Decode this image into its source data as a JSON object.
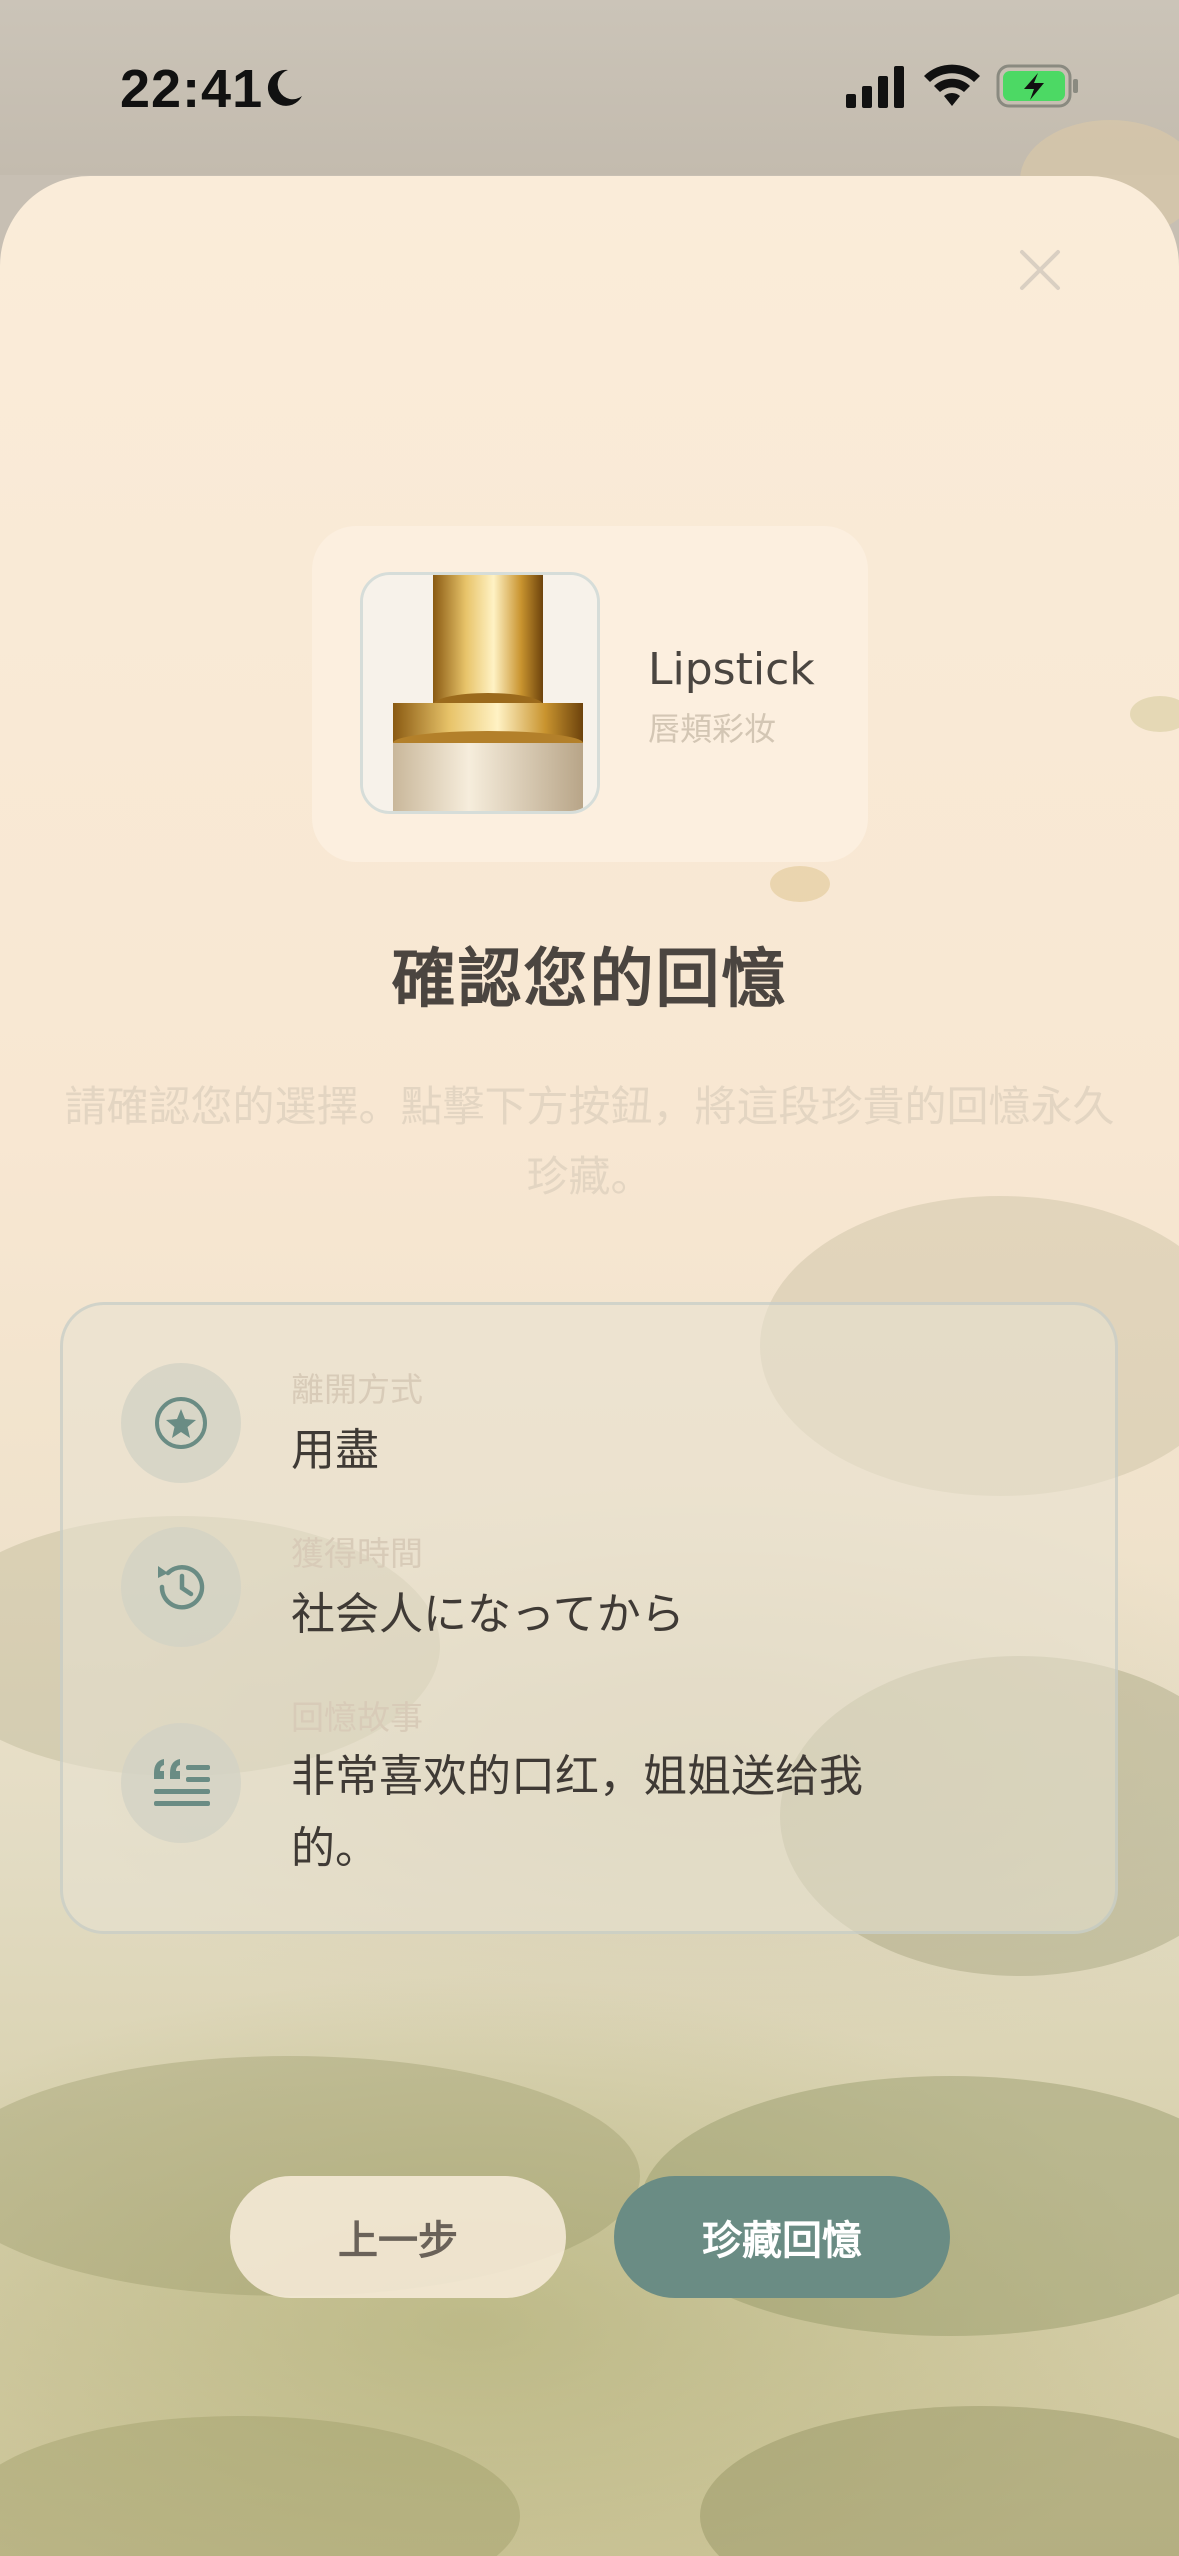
{
  "status_bar": {
    "time": "22:41",
    "moon_icon": "moon-icon",
    "signal_icon": "cellular-signal-icon",
    "wifi_icon": "wifi-icon",
    "battery_icon": "battery-charging-icon",
    "battery_color": "#4cd964"
  },
  "sheet": {
    "close_icon": "close-icon",
    "item": {
      "name": "Lipstick",
      "category": "唇頬彩妆",
      "thumbnail_icon": "lipstick-image"
    },
    "title": "確認您的回憶",
    "subtitle": "請確認您的選擇。點擊下方按鈕，將這段珍貴的回憶永久珍藏。",
    "details": [
      {
        "label": "離開方式",
        "value": "用盡",
        "icon": "star-circle-icon"
      },
      {
        "label": "獲得時間",
        "value": "社会人になってから",
        "icon": "history-icon"
      },
      {
        "label": "回憶故事",
        "value": "非常喜欢的口红，姐姐送给我的。",
        "icon": "quote-text-icon"
      }
    ],
    "buttons": {
      "back_label": "上一步",
      "confirm_label": "珍藏回憶"
    }
  },
  "colors": {
    "accent": "#6a8c84",
    "title_text": "#4b4540",
    "muted_text": "#e3d5c2"
  }
}
